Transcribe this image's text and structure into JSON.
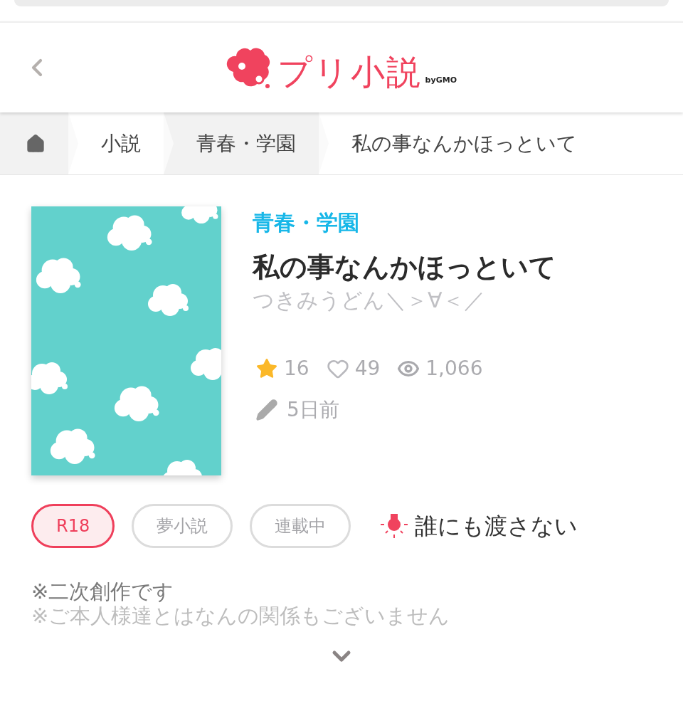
{
  "header": {
    "logo_text": "プリ小説",
    "logo_suffix": "byGMO"
  },
  "breadcrumb": [
    {
      "kind": "home"
    },
    {
      "kind": "text",
      "label": "小説"
    },
    {
      "kind": "text",
      "label": "青春・学園"
    },
    {
      "kind": "text",
      "label": "私の事なんかほっといて"
    }
  ],
  "novel": {
    "genre": "青春・学園",
    "title": "私の事なんかほっといて",
    "author": "つきみうどん＼＞∀＜／",
    "stats": [
      {
        "kind": "star",
        "value": "16"
      },
      {
        "kind": "heart",
        "value": "49"
      },
      {
        "kind": "view",
        "value": "1,066"
      }
    ],
    "updated": "5日前"
  },
  "tags": [
    {
      "label": "R18",
      "kind": "warning"
    },
    {
      "label": "夢小説",
      "kind": "normal"
    },
    {
      "label": "連載中",
      "kind": "normal"
    }
  ],
  "hint": "誰にも渡さない",
  "description": [
    "※二次創作です",
    "※ご本人様達とはなんの関係もございません"
  ]
}
